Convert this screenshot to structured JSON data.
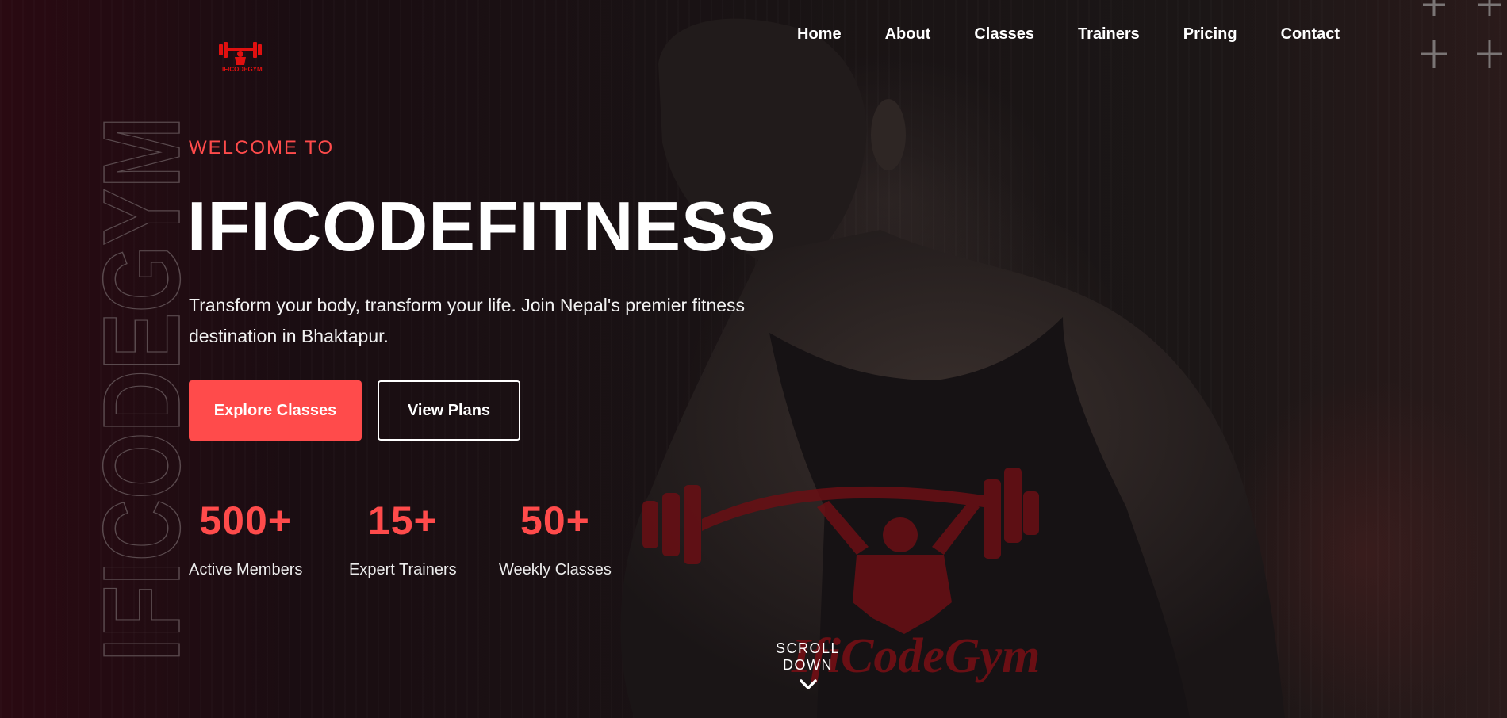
{
  "brand": {
    "logo_text": "IFICODEGYM"
  },
  "nav": {
    "items": [
      {
        "label": "Home"
      },
      {
        "label": "About"
      },
      {
        "label": "Classes"
      },
      {
        "label": "Trainers"
      },
      {
        "label": "Pricing"
      },
      {
        "label": "Contact"
      }
    ]
  },
  "side_text": "IFICODEGYM",
  "hero": {
    "eyebrow": "WELCOME TO",
    "title": "IFICODEFITNESS",
    "subtitle": "Transform your body, transform your life. Join Nepal's premier fitness destination in Bhaktapur.",
    "primary_button": "Explore Classes",
    "secondary_button": "View Plans"
  },
  "stats": [
    {
      "value": "500+",
      "label": "Active Members"
    },
    {
      "value": "15+",
      "label": "Expert Trainers"
    },
    {
      "value": "50+",
      "label": "Weekly Classes"
    }
  ],
  "scroll": {
    "label": "SCROLL DOWN"
  },
  "tank_print": {
    "text": "IfiCodeGym"
  },
  "colors": {
    "accent": "#ff4b4b",
    "background": "#140e10",
    "text": "#ffffff"
  },
  "icons": [
    "weightlifter-logo-icon",
    "plus-icon",
    "chevron-down-icon"
  ]
}
